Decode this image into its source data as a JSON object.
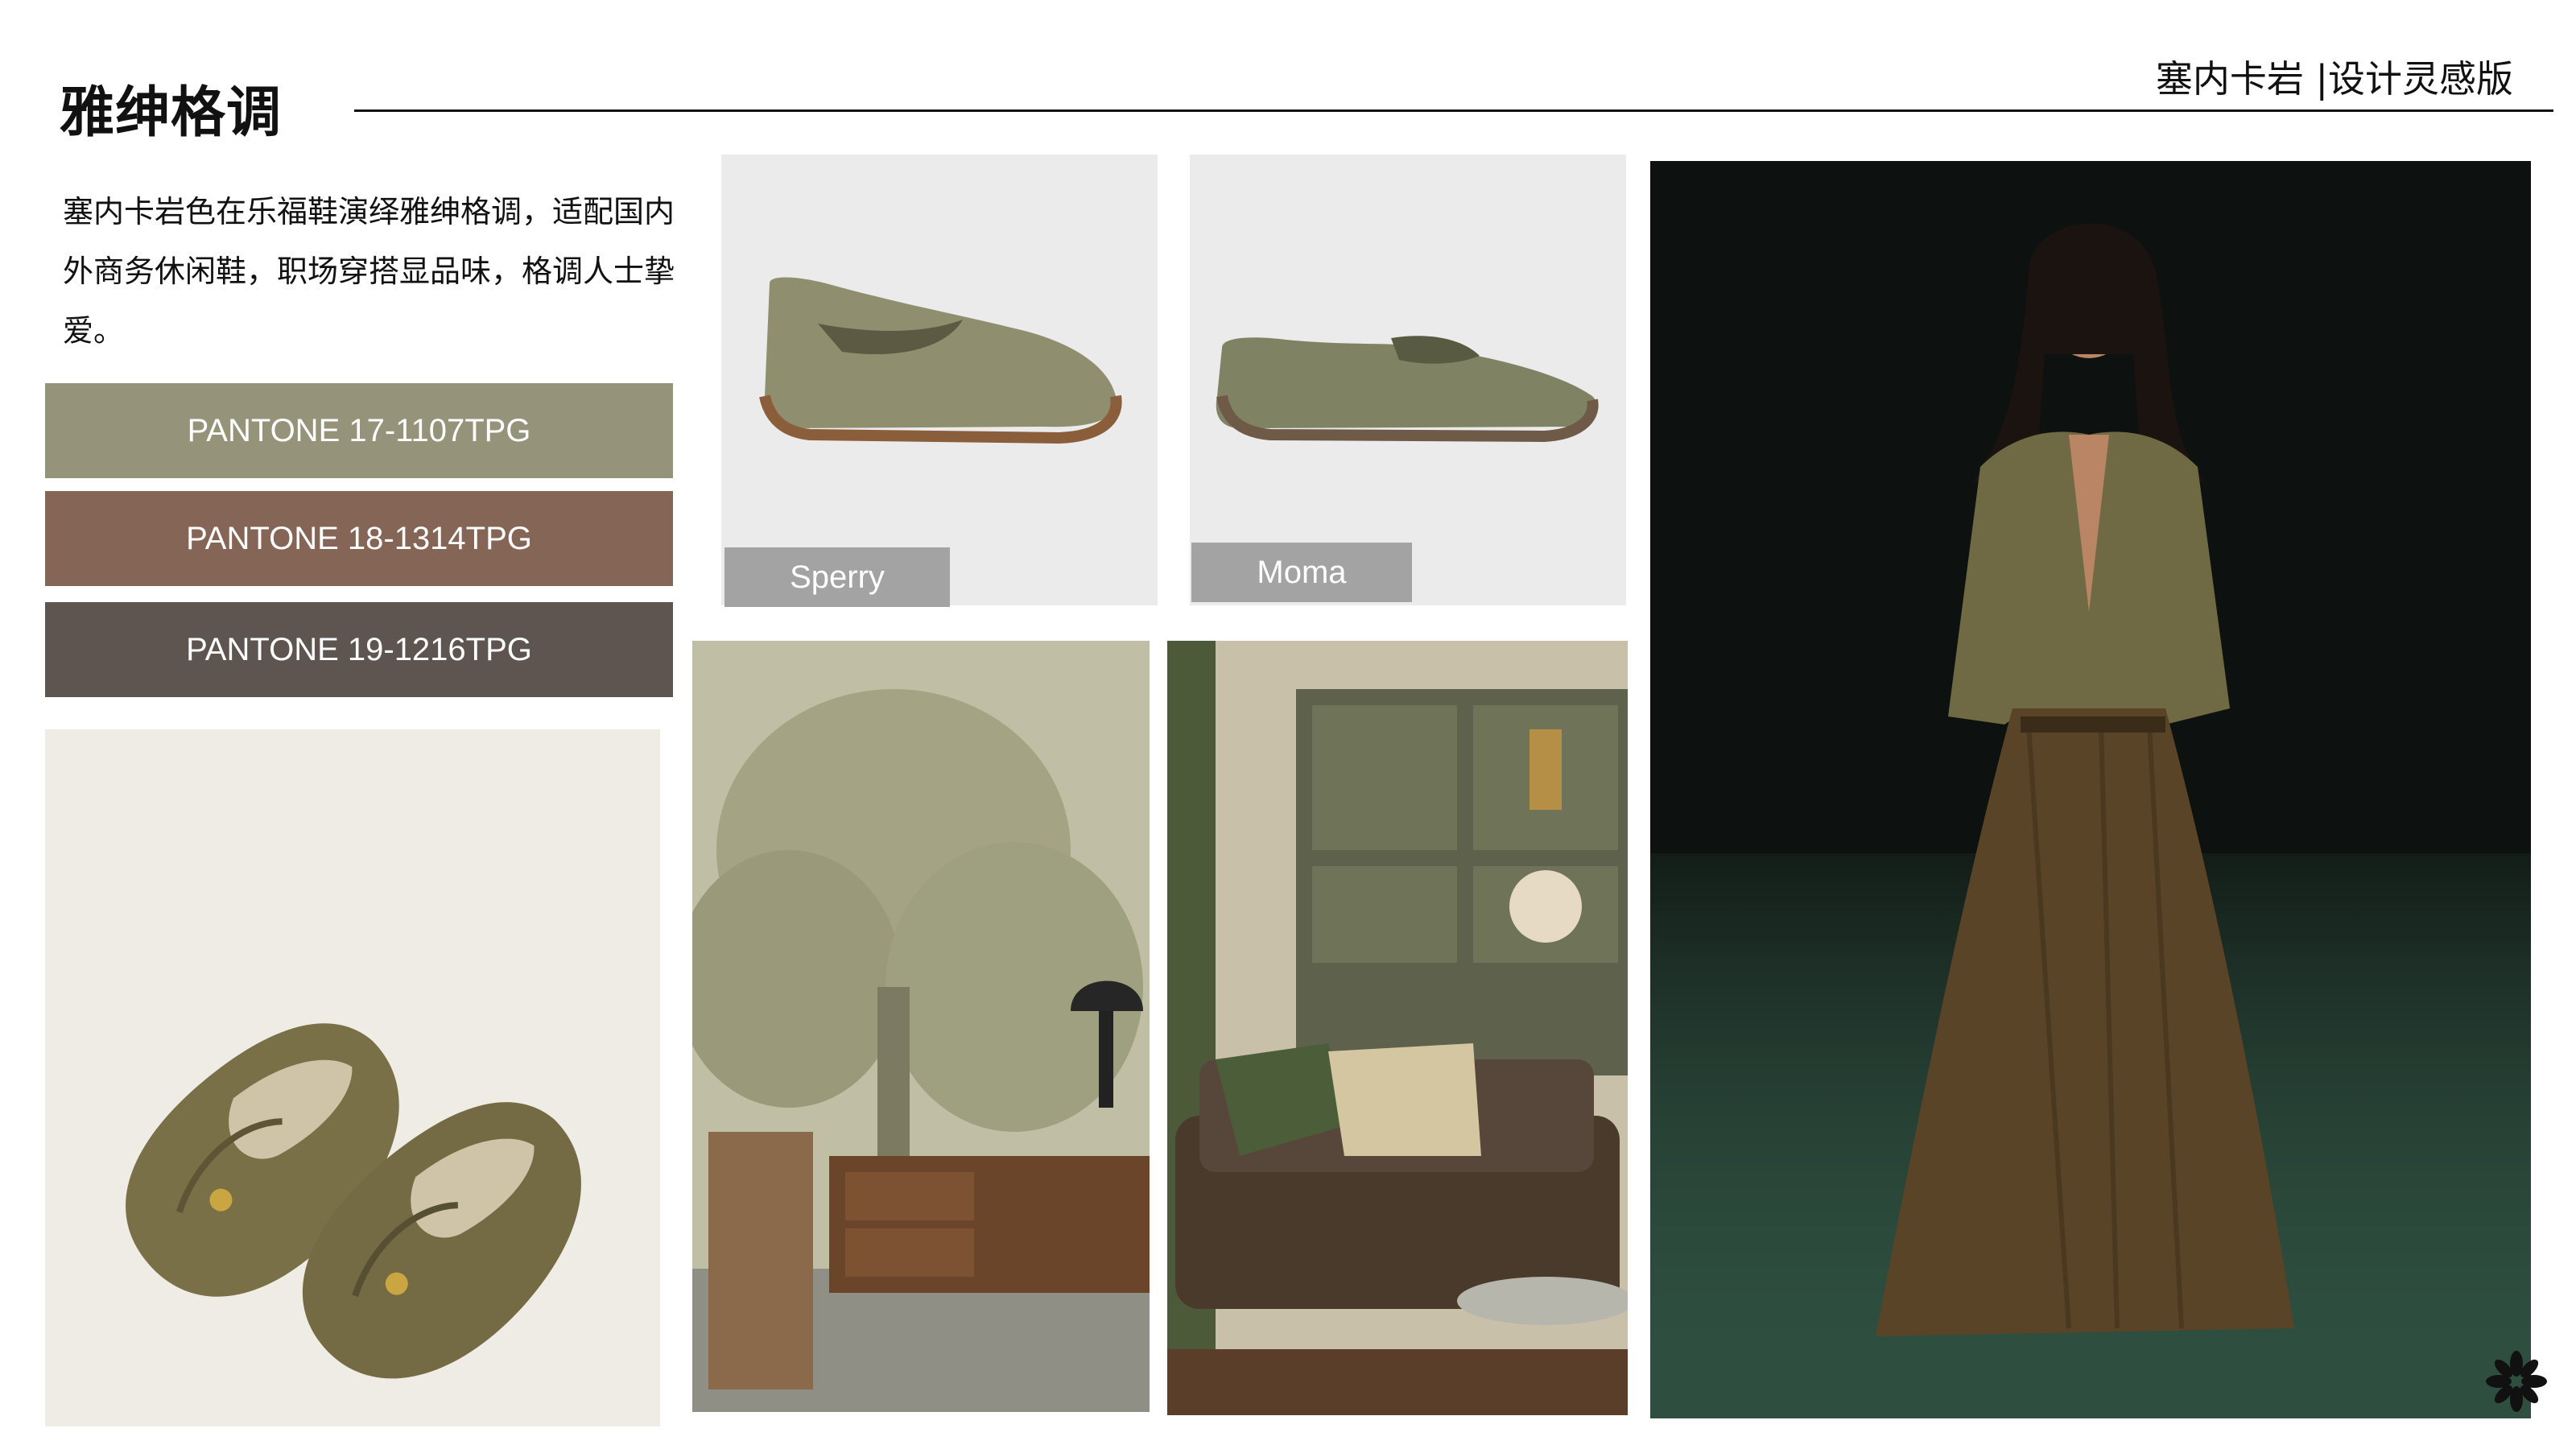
{
  "header": {
    "title": "雅绅格调",
    "brand": "塞内卡岩 |设计灵感版"
  },
  "description": "塞内卡岩色在乐福鞋演绎雅绅格调，适配国内外商务休闲鞋，职场穿搭显品味，格调人士挚爱。",
  "swatches": [
    {
      "label": "PANTONE 17-1107TPG",
      "color": "#96937b"
    },
    {
      "label": "PANTONE 18-1314TPG",
      "color": "#846556"
    },
    {
      "label": "PANTONE 19-1216TPG",
      "color": "#5e5551"
    }
  ],
  "images": {
    "sperry": {
      "caption": "Sperry"
    },
    "moma": {
      "caption": "Moma"
    }
  },
  "icons": {
    "corner": "asterisk-flower-icon"
  }
}
